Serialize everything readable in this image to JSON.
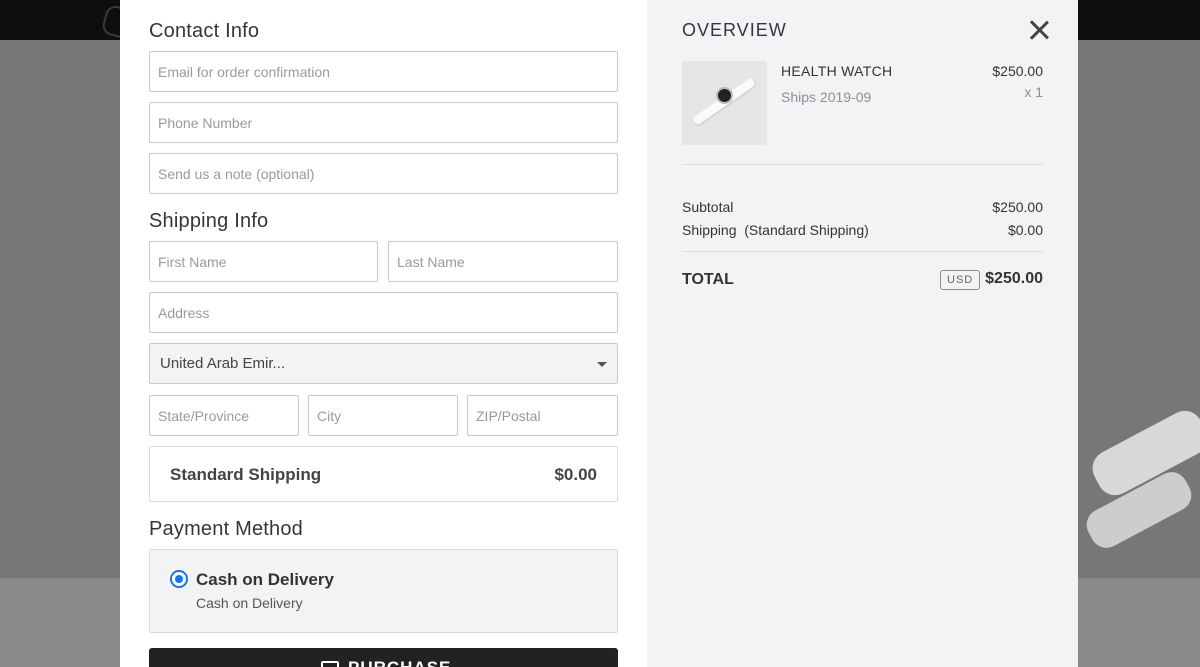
{
  "contact": {
    "title": "Contact Info",
    "email_placeholder": "Email for order confirmation",
    "phone_placeholder": "Phone Number",
    "note_placeholder": "Send us a note (optional)"
  },
  "shipping": {
    "title": "Shipping Info",
    "first_name_placeholder": "First Name",
    "last_name_placeholder": "Last Name",
    "address_placeholder": "Address",
    "country_value": "United Arab Emir...",
    "state_placeholder": "State/Province",
    "city_placeholder": "City",
    "zip_placeholder": "ZIP/Postal",
    "method_label": "Standard Shipping",
    "method_price": "$0.00"
  },
  "payment": {
    "title": "Payment Method",
    "option_label": "Cash on Delivery",
    "option_sub": "Cash on Delivery",
    "purchase_label": "PURCHASE"
  },
  "overview": {
    "title": "OVERVIEW",
    "item": {
      "name": "HEALTH WATCH",
      "ships": "Ships 2019-09",
      "price": "$250.00",
      "qty": "x 1"
    },
    "subtotal_label": "Subtotal",
    "subtotal_value": "$250.00",
    "shipping_label": "Shipping  (Standard Shipping)",
    "shipping_value": "$0.00",
    "total_label": "TOTAL",
    "currency": "USD",
    "total_value": "$250.00"
  },
  "colors": {
    "accent": "#1a73e8",
    "button_bg": "#222222",
    "panel_bg": "#f3f3f5"
  }
}
